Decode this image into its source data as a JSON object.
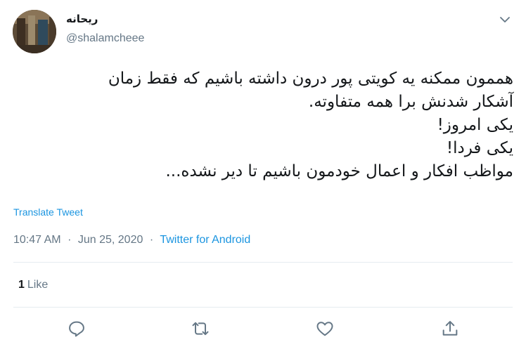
{
  "user": {
    "display_name": "ریحانه",
    "handle": "@shalamcheee"
  },
  "tweet": {
    "lines": [
      "هممون ممکنه یه کویتی پور درون داشته باشیم که فقط زمان",
      "آشکار شدنش برا همه متفاوته.",
      "یکی امروز!",
      "یکی فردا!",
      "مواظب افکار و اعمال خودمون باشیم تا دیر نشده..."
    ],
    "translate_label": "Translate Tweet",
    "time": "10:47 AM",
    "separator": "·",
    "date": "Jun 25, 2020",
    "source": "Twitter for Android",
    "like_count": "1",
    "like_label": "Like"
  },
  "icons": {
    "caret": "chevron-down-icon",
    "reply": "reply-icon",
    "retweet": "retweet-icon",
    "like": "heart-icon",
    "share": "share-icon"
  },
  "colors": {
    "text": "#14171a",
    "secondary": "#657786",
    "link": "#1b95e0",
    "divider": "#e6ecf0"
  }
}
